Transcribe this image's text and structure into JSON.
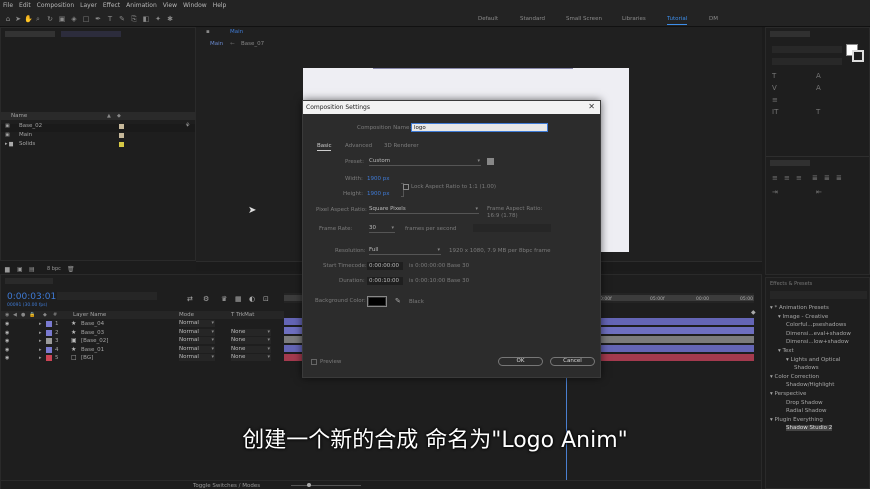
{
  "menu": [
    "File",
    "Edit",
    "Composition",
    "Layer",
    "Effect",
    "Animation",
    "View",
    "Window",
    "Help"
  ],
  "workspaces": [
    "Default",
    "Standard",
    "Small Screen",
    "Libraries",
    "Tutorial",
    "DM"
  ],
  "active_workspace": "Tutorial",
  "comp_viewer": {
    "breadcrumb_main": "Main",
    "breadcrumb_sep": "←",
    "breadcrumb_sub": "Base_07"
  },
  "project": {
    "column_name": "Name",
    "items": [
      {
        "name": "Base_02",
        "color": "#c6b89a"
      },
      {
        "name": "Main",
        "color": "#c6b89a"
      },
      {
        "name": "Solids",
        "color": "#d6c845"
      }
    ],
    "bpc": "8 bpc"
  },
  "timeline": {
    "timecode": "0:00:03:01",
    "frame_info": "00091 (30.00 fps)",
    "col_layer_name": "Layer Name",
    "col_mode": "Mode",
    "col_trkmat": "T TrkMat",
    "layers": [
      {
        "num": "1",
        "name": "Base_04",
        "mode": "Normal",
        "trkmat": "",
        "color": "#7a7ad0"
      },
      {
        "num": "2",
        "name": "Base_03",
        "mode": "Normal",
        "trkmat": "None",
        "color": "#7a7ad0"
      },
      {
        "num": "3",
        "name": "[Base_02]",
        "mode": "Normal",
        "trkmat": "None",
        "color": "#9a9a9a"
      },
      {
        "num": "4",
        "name": "Base_01",
        "mode": "Normal",
        "trkmat": "None",
        "color": "#7a7ad0"
      },
      {
        "num": "5",
        "name": "[BG]",
        "mode": "Normal",
        "trkmat": "None",
        "color": "#cc4455"
      }
    ],
    "ruler": [
      "0:00f",
      "05:00f",
      "00:00",
      "05:00"
    ],
    "footer": "Toggle Switches / Modes"
  },
  "dialog": {
    "title": "Composition Settings",
    "close": "✕",
    "name_label": "Composition Name:",
    "name_value": "logo",
    "tabs": [
      "Basic",
      "Advanced",
      "3D Renderer"
    ],
    "preset_label": "Preset:",
    "preset_value": "Custom",
    "width_label": "Width:",
    "width_value": "1900 px",
    "height_label": "Height:",
    "height_value": "1900 px",
    "lock_label": "Lock Aspect Ratio to 1:1 (1.00)",
    "par_label": "Pixel Aspect Ratio:",
    "par_value": "Square Pixels",
    "frame_aspect_label": "Frame Aspect Ratio:",
    "frame_aspect_value": "16:9 (1.78)",
    "fps_label": "Frame Rate:",
    "fps_value": "30",
    "fps_unit": "frames per second",
    "resolution_label": "Resolution:",
    "resolution_value": "Full",
    "resolution_info": "1920 x 1080, 7.9 MB per 8bpc frame",
    "start_label": "Start Timecode:",
    "start_value": "0:00:00:00",
    "start_info": "is 0:00:00:00  Base 30",
    "duration_label": "Duration:",
    "duration_value": "0:00:10:00",
    "duration_info": "is 0:00:10:00  Base 30",
    "bg_label": "Background Color:",
    "bg_name": "Black",
    "bg_color": "#000000",
    "preview_label": "Preview",
    "ok": "OK",
    "cancel": "Cancel"
  },
  "effects_panel": {
    "title": "Effects & Presets",
    "items": [
      {
        "text": "▾ * Animation Presets",
        "indent": 0
      },
      {
        "text": "▾ Image - Creative",
        "indent": 1
      },
      {
        "text": "Colorful...pseshadows",
        "indent": 2
      },
      {
        "text": "Dimensi...eval+shadow",
        "indent": 2
      },
      {
        "text": "Dimensi...low+shadow",
        "indent": 2
      },
      {
        "text": "▾ Text",
        "indent": 1
      },
      {
        "text": "▾ Lights and Optical",
        "indent": 2
      },
      {
        "text": "Shadows",
        "indent": 3
      },
      {
        "text": "▾ Color Correction",
        "indent": 0
      },
      {
        "text": "Shadow/Highlight",
        "indent": 2
      },
      {
        "text": "▾ Perspective",
        "indent": 0
      },
      {
        "text": "Drop Shadow",
        "indent": 2
      },
      {
        "text": "Radial Shadow",
        "indent": 2
      },
      {
        "text": "▾ Plugin Everything",
        "indent": 0
      },
      {
        "text": "Shadow Studio 2",
        "indent": 2
      }
    ]
  },
  "subtitle": "创建一个新的合成 命名为\"Logo Anim\""
}
